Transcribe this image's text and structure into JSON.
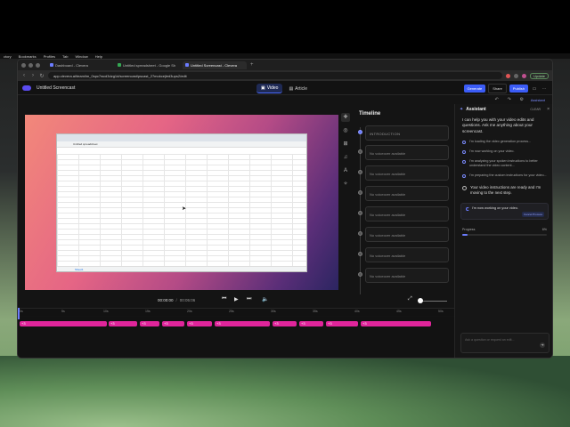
{
  "menubar": {
    "items": [
      "ctory",
      "Bookmarks",
      "Profiles",
      "Tab",
      "Window",
      "Help"
    ]
  },
  "browser": {
    "tabs": [
      {
        "label": "Dashboard - Clevera",
        "color": "#6b7cff",
        "active": false
      },
      {
        "label": "Untitled spreadsheet - Google Sh",
        "color": "#34a853",
        "active": false
      },
      {
        "label": "Untitled Screencast - Clevera",
        "color": "#6b7cff",
        "active": true
      }
    ],
    "url": "app.clevera.ai/team/im_0spc7wcd3dzg1d/screencast/pscast_27mokcejled3ups2/edit",
    "update_label": "Update"
  },
  "app": {
    "title": "Untitled Screencast",
    "mode_tabs": [
      {
        "label": "Video",
        "icon": "video-icon",
        "active": true
      },
      {
        "label": "Article",
        "icon": "article-icon",
        "active": false
      }
    ],
    "generate_label": "Generate",
    "share_label": "Share",
    "publish_label": "Publish",
    "assistant_toggle_label": "Assistant"
  },
  "preview": {
    "sheet_title": "Untitled spreadsheet",
    "sheet_tab": "Sheet1"
  },
  "timeline": {
    "title": "Timeline",
    "items": [
      "INTRODUCTION",
      "No voiceover available",
      "No voiceover available",
      "No voiceover available",
      "No voiceover available",
      "No voiceover available",
      "No voiceover available",
      "No voiceover available",
      "No voiceover available"
    ]
  },
  "assistant": {
    "title": "Assistant",
    "clear_label": "CLEAR",
    "intro": "I can help you with your video edits and questions. Ask me anything about your screencast.",
    "steps": [
      "I'm loading the video generation process...",
      "I'm now working on your video.",
      "I'm analyzing your spoken instructions to better understand the video content...",
      "I'm preparing the custom instructions for your video..."
    ],
    "done_text": "Your video instructions are ready and I'm moving to the next step.",
    "working_text": "I'm now working on your video.",
    "cancel_label": "Cancel Process",
    "progress_label": "Progress",
    "progress_value": "6%",
    "progress_fraction": 0.06,
    "input_placeholder": "Ask a question or request an edit..."
  },
  "player": {
    "current_time": "00:00:00",
    "duration": "00:05:06"
  },
  "ruler": {
    "labels": [
      "0s",
      "5s",
      "10s",
      "15s",
      "20s",
      "25s",
      "30s",
      "35s",
      "40s",
      "45s",
      "50s"
    ]
  },
  "clips": [
    "+3",
    "+3",
    "+3",
    "+3",
    "+3",
    "+3",
    "+3",
    "+3",
    "+3",
    "+3"
  ]
}
